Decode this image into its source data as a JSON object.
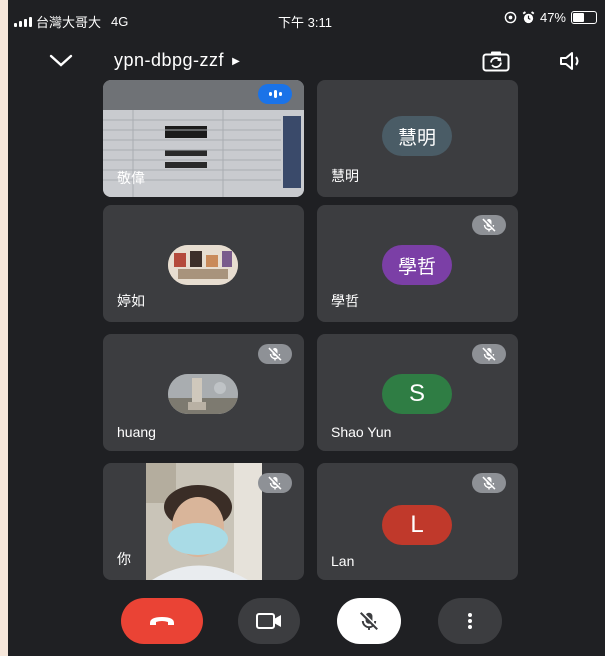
{
  "status_bar": {
    "carrier": "台灣大哥大",
    "network": "4G",
    "time": "下午 3:11",
    "battery": "47%"
  },
  "meeting": {
    "code": "ypn-dbpg-zzf"
  },
  "colors": {
    "end_call": "#ea4335",
    "speaking": "#1a73e8",
    "avatar_huiming": "#4a5c66",
    "avatar_xuezhe": "#7b3fa6",
    "avatar_shaoyun": "#2f7d44",
    "avatar_lan": "#c0392b"
  },
  "participants": [
    {
      "name": "敬偉",
      "type": "screen",
      "muted": false,
      "speaking": true
    },
    {
      "name": "慧明",
      "type": "initials",
      "initials": "慧明",
      "muted": false
    },
    {
      "name": "婷如",
      "type": "photo",
      "muted": false
    },
    {
      "name": "學哲",
      "type": "initials",
      "initials": "學哲",
      "muted": true
    },
    {
      "name": "huang",
      "type": "photo",
      "muted": true
    },
    {
      "name": "Shao Yun",
      "type": "initials",
      "initials": "S",
      "muted": true
    },
    {
      "name": "你",
      "type": "camera",
      "muted": true
    },
    {
      "name": "Lan",
      "type": "initials",
      "initials": "L",
      "muted": true
    }
  ],
  "controls": [
    "end-call",
    "camera",
    "microphone",
    "more"
  ]
}
